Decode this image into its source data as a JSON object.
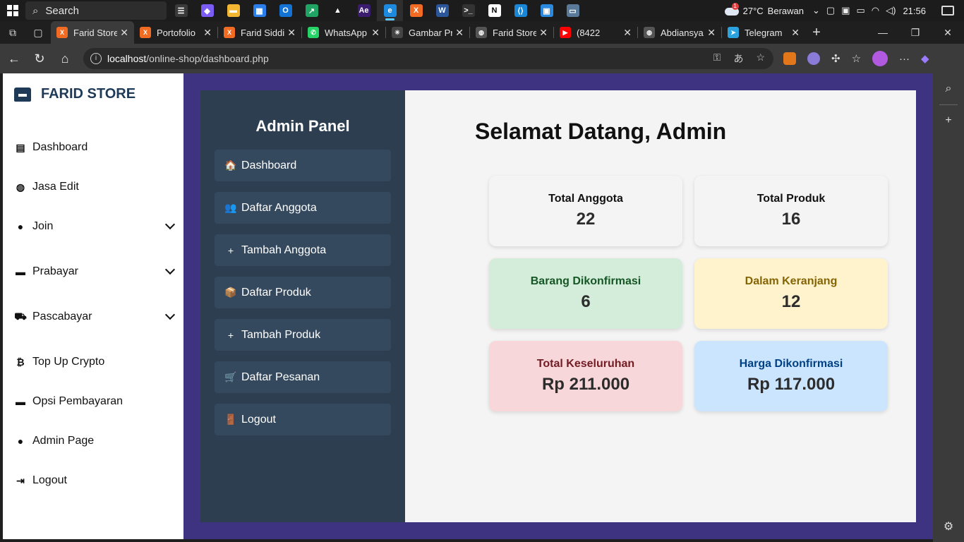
{
  "taskbar": {
    "search_placeholder": "Search",
    "weather_temp": "27°C",
    "weather_desc": "Berawan",
    "weather_alert": "1",
    "time": "21:56",
    "apps": [
      {
        "icon": "task-view-icon",
        "color": "#3a3a3a",
        "glyph": "☰"
      },
      {
        "icon": "copilot-icon",
        "color": "#7b5cf5",
        "glyph": "◆"
      },
      {
        "icon": "file-explorer-icon",
        "color": "#f2b632",
        "glyph": "▬"
      },
      {
        "icon": "store-icon",
        "color": "#2b7de9",
        "glyph": "▦"
      },
      {
        "icon": "outlook-icon",
        "color": "#1273d4",
        "glyph": "O"
      },
      {
        "icon": "sheets-icon",
        "color": "#1fa463",
        "glyph": "↗"
      },
      {
        "icon": "linux-icon",
        "color": "#1c1c1c",
        "glyph": "▲"
      },
      {
        "icon": "after-effects-icon",
        "color": "#3a1d6e",
        "glyph": "Ae"
      },
      {
        "icon": "edge-icon",
        "color": "#1b8adf",
        "glyph": "e",
        "active": true
      },
      {
        "icon": "xampp-icon",
        "color": "#f26b23",
        "glyph": "X"
      },
      {
        "icon": "word-icon",
        "color": "#2b579a",
        "glyph": "W"
      },
      {
        "icon": "terminal-icon",
        "color": "#333333",
        "glyph": ">_"
      },
      {
        "icon": "notion-icon",
        "color": "#ffffff",
        "glyph": "N"
      },
      {
        "icon": "vscode-icon",
        "color": "#1a86d6",
        "glyph": "⟨⟩"
      },
      {
        "icon": "photos-icon",
        "color": "#2a8ae0",
        "glyph": "▣"
      },
      {
        "icon": "remote-desktop-icon",
        "color": "#5a7a9a",
        "glyph": "▭"
      }
    ]
  },
  "browser": {
    "tabs": [
      {
        "label": "Farid Store",
        "favicon": "xampp-icon",
        "color": "#f26b23",
        "glyph": "X",
        "active": true
      },
      {
        "label": "Portofolio",
        "favicon": "xampp-icon",
        "color": "#f26b23",
        "glyph": "X"
      },
      {
        "label": "Farid Siddi",
        "favicon": "xampp-icon",
        "color": "#f26b23",
        "glyph": "X"
      },
      {
        "label": "WhatsApp",
        "favicon": "whatsapp-icon",
        "color": "#25d366",
        "glyph": "✆"
      },
      {
        "label": "Gambar Pr",
        "favicon": "chatgpt-icon",
        "color": "#444444",
        "glyph": "✳"
      },
      {
        "label": "Farid Store",
        "favicon": "globe-icon",
        "color": "#555555",
        "glyph": "◍"
      },
      {
        "label": "(8422",
        "favicon": "youtube-icon",
        "color": "#ff0000",
        "glyph": "▶"
      },
      {
        "label": "Abdiansya",
        "favicon": "globe-icon",
        "color": "#555555",
        "glyph": "◍"
      },
      {
        "label": "Telegram",
        "favicon": "telegram-icon",
        "color": "#2aa3df",
        "glyph": "➤"
      }
    ],
    "url_host": "localhost",
    "url_path": "/online-shop/dashboard.php"
  },
  "site": {
    "brand": "FARID STORE",
    "nav": [
      {
        "label": "Dashboard",
        "icon": "store-icon",
        "glyph": "▤",
        "dropdown": false
      },
      {
        "label": "Jasa Edit",
        "icon": "globe-icon",
        "glyph": "◍",
        "dropdown": false
      },
      {
        "label": "Join",
        "icon": "user-icon",
        "glyph": "●",
        "dropdown": true
      },
      {
        "label": "Prabayar",
        "icon": "wallet-icon",
        "glyph": "▬",
        "dropdown": true
      },
      {
        "label": "Pascabayar",
        "icon": "cart-icon",
        "glyph": "⛟",
        "dropdown": true
      },
      {
        "label": "Top Up Crypto",
        "icon": "bitcoin-icon",
        "glyph": "₿",
        "dropdown": false
      },
      {
        "label": "Opsi Pembayaran",
        "icon": "wallet-icon",
        "glyph": "▬",
        "dropdown": false
      },
      {
        "label": "Admin Page",
        "icon": "user-shield-icon",
        "glyph": "●",
        "dropdown": false
      },
      {
        "label": "Logout",
        "icon": "logout-icon",
        "glyph": "⇥",
        "dropdown": false
      }
    ]
  },
  "admin": {
    "title": "Admin Panel",
    "welcome": "Selamat Datang, Admin",
    "menu": [
      {
        "label": "Dashboard",
        "icon": "house-icon",
        "glyph": "🏠"
      },
      {
        "label": "Daftar Anggota",
        "icon": "people-icon",
        "glyph": "👥"
      },
      {
        "label": "Tambah Anggota",
        "icon": "plus-icon",
        "glyph": "+"
      },
      {
        "label": "Daftar Produk",
        "icon": "box-icon",
        "glyph": "📦"
      },
      {
        "label": "Tambah Produk",
        "icon": "plus-icon",
        "glyph": "+"
      },
      {
        "label": "Daftar Pesanan",
        "icon": "cart-icon",
        "glyph": "🛒"
      },
      {
        "label": "Logout",
        "icon": "door-icon",
        "glyph": "🚪"
      }
    ],
    "cards": [
      {
        "label": "Total Anggota",
        "value": "22",
        "bg": "#f4f4f4",
        "fg": "#111111"
      },
      {
        "label": "Total Produk",
        "value": "16",
        "bg": "#f4f4f4",
        "fg": "#111111"
      },
      {
        "label": "Barang Dikonfirmasi",
        "value": "6",
        "bg": "#d4edda",
        "fg": "#155724"
      },
      {
        "label": "Dalam Keranjang",
        "value": "12",
        "bg": "#fff3cd",
        "fg": "#856404"
      },
      {
        "label": "Total Keseluruhan",
        "value": "Rp 211.000",
        "bg": "#f8d7da",
        "fg": "#721c24"
      },
      {
        "label": "Harga Dikonfirmasi",
        "value": "Rp 117.000",
        "bg": "#cce5ff",
        "fg": "#004085"
      }
    ]
  }
}
